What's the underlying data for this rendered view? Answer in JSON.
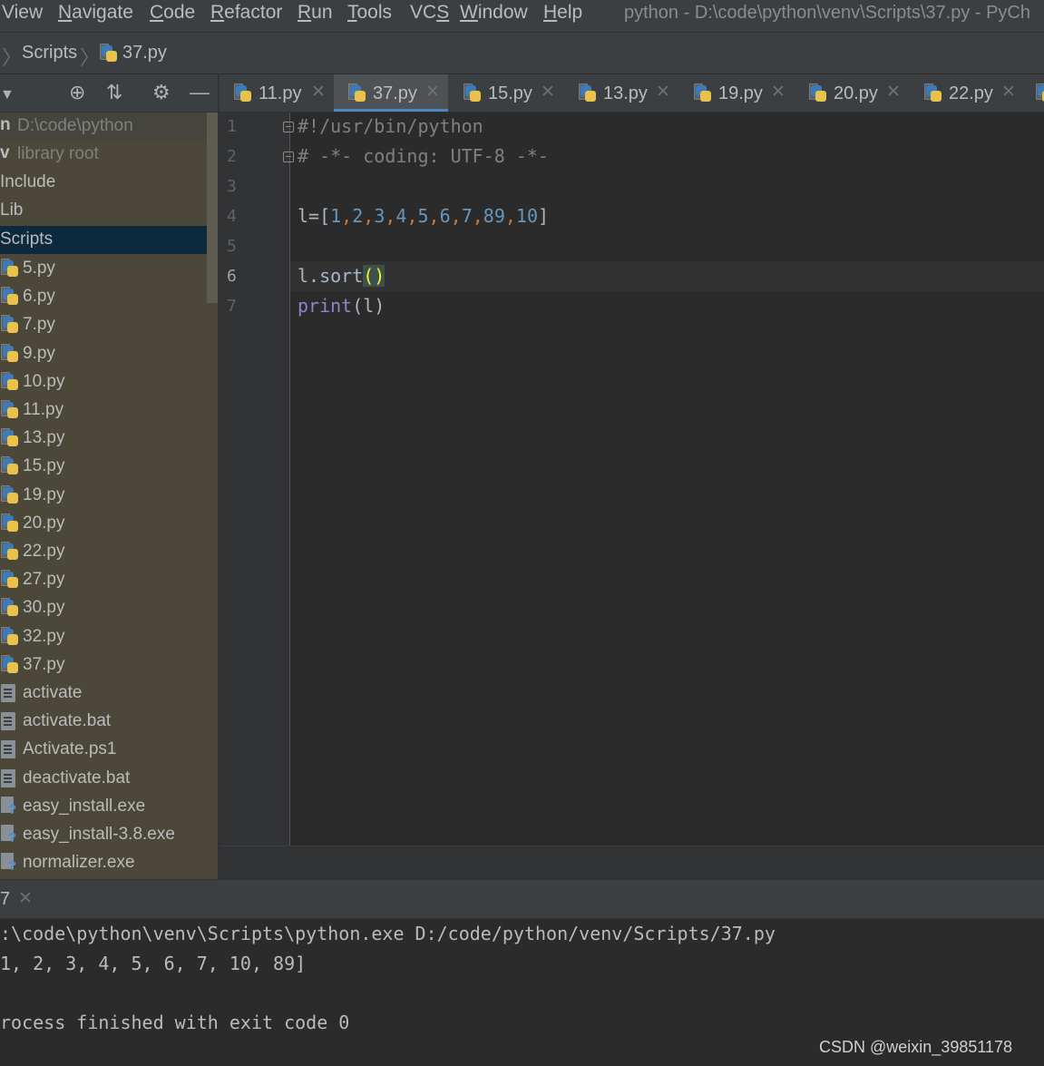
{
  "menu": {
    "items": [
      "View",
      "Navigate",
      "Code",
      "Refactor",
      "Run",
      "Tools",
      "VCS",
      "Window",
      "Help"
    ],
    "window_title": "python - D:\\code\\python\\venv\\Scripts\\37.py - PyCh"
  },
  "breadcrumb": {
    "items": [
      "Scripts",
      "37.py"
    ]
  },
  "project_panel": {
    "root_prefix": "n",
    "root_path": "D:\\code\\python",
    "venv_prefix": "v",
    "venv_label": "library root",
    "folders": [
      "Include",
      "Lib",
      "Scripts"
    ],
    "selected": "Scripts",
    "py_files": [
      "5.py",
      "6.py",
      "7.py",
      "9.py",
      "10.py",
      "11.py",
      "13.py",
      "15.py",
      "19.py",
      "20.py",
      "22.py",
      "27.py",
      "30.py",
      "32.py",
      "37.py"
    ],
    "text_files": [
      "activate",
      "activate.bat",
      "Activate.ps1",
      "deactivate.bat"
    ],
    "exe_files": [
      "easy_install.exe",
      "easy_install-3.8.exe",
      "normalizer.exe"
    ]
  },
  "tabs": [
    {
      "label": "11.py",
      "active": false
    },
    {
      "label": "37.py",
      "active": true
    },
    {
      "label": "15.py",
      "active": false
    },
    {
      "label": "13.py",
      "active": false
    },
    {
      "label": "19.py",
      "active": false
    },
    {
      "label": "20.py",
      "active": false
    },
    {
      "label": "22.py",
      "active": false
    }
  ],
  "editor": {
    "line_numbers": [
      "1",
      "2",
      "3",
      "4",
      "5",
      "6",
      "7"
    ],
    "current_line": "6",
    "lines": {
      "l1": "#!/usr/bin/python",
      "l2": "# -*- coding: UTF-8 -*-",
      "l4_prefix": "l=[",
      "l4_values": [
        "1",
        "2",
        "3",
        "4",
        "5",
        "6",
        "7",
        "89",
        "10"
      ],
      "l4_suffix": "]",
      "l6_prefix": "l.sort",
      "l6_parens": "()",
      "l7_builtin": "print",
      "l7_args": "(l)"
    }
  },
  "run_panel": {
    "tab_label": "7",
    "console": [
      ":\\code\\python\\venv\\Scripts\\python.exe D:/code/python/venv/Scripts/37.py",
      "1, 2, 3, 4, 5, 6, 7, 10, 89]",
      "",
      "rocess finished with exit code 0"
    ]
  },
  "watermark": "CSDN @weixin_39851178",
  "colors": {
    "accent": "#4a88c7",
    "selection": "#0d293e",
    "tree_bg": "#4b4739",
    "editor_bg": "#2b2b2b"
  }
}
